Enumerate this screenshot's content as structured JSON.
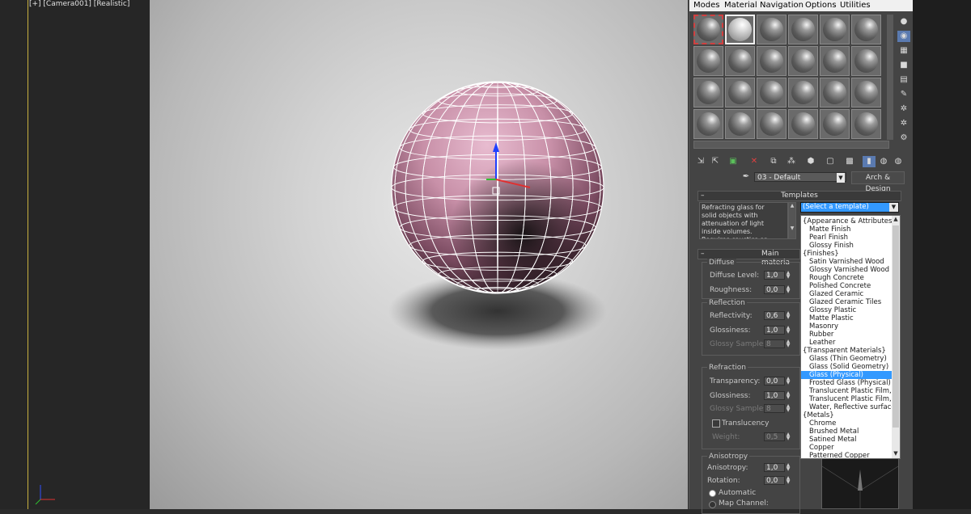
{
  "viewport": {
    "label": "[+] [Camera001] [Realistic]"
  },
  "material_editor": {
    "menu": [
      "Modes",
      "Material",
      "Navigation",
      "Options",
      "Utilities"
    ],
    "material_name": "03 - Default",
    "material_type": "Arch & Design",
    "templates": {
      "header": "Templates",
      "description": "Refracting glass for solid objects with attenuation of light inside volumes. Requires caustics  or",
      "selected": "(Select a template)",
      "items": [
        "{Appearance & Attributes}",
        "Matte Finish",
        "Pearl Finish",
        "Glossy Finish",
        "{Finishes}",
        "Satin Varnished Wood",
        "Glossy Varnished Wood",
        "Rough Concrete",
        "Polished Concrete",
        "Glazed Ceramic",
        "Glazed Ceramic Tiles",
        "Glossy Plastic",
        "Matte Plastic",
        "Masonry",
        "Rubber",
        "Leather",
        "{Transparent Materials}",
        "Glass (Thin Geometry)",
        "Glass (Solid Geometry)",
        "Glass (Physical)",
        "Frosted Glass (Physical)",
        "Translucent Plastic Film, Lig",
        "Translucent Plastic Film, Op",
        "Water, Reflective surface",
        "{Metals}",
        "Chrome",
        "Brushed Metal",
        "Satined Metal",
        "Copper",
        "Patterned Copper"
      ],
      "highlighted": "Glass (Physical)"
    },
    "main_material": {
      "header": "Main materia",
      "diffuse": {
        "title": "Diffuse",
        "level_label": "Diffuse Level:",
        "level": "1,0",
        "roughness_label": "Roughness:",
        "roughness": "0,0"
      },
      "reflection": {
        "title": "Reflection",
        "reflectivity_label": "Reflectivity:",
        "reflectivity": "0,6",
        "glossiness_label": "Glossiness:",
        "glossiness": "1,0",
        "samples_label": "Glossy Samples:",
        "samples": "8"
      },
      "refraction": {
        "title": "Refraction",
        "transparency_label": "Transparency:",
        "transparency": "0,0",
        "glossiness_label": "Glossiness:",
        "glossiness": "1,0",
        "samples_label": "Glossy Samples:",
        "samples": "8"
      },
      "translucency": {
        "label": "Translucency",
        "weight_label": "Weight:",
        "weight": "0,5"
      },
      "anisotropy": {
        "title": "Anisotropy",
        "anisotropy_label": "Anisotropy:",
        "anisotropy": "1,0",
        "rotation_label": "Rotation:",
        "rotation": "0,0",
        "automatic": "Automatic",
        "map_channel": "Map Channel:"
      }
    }
  }
}
